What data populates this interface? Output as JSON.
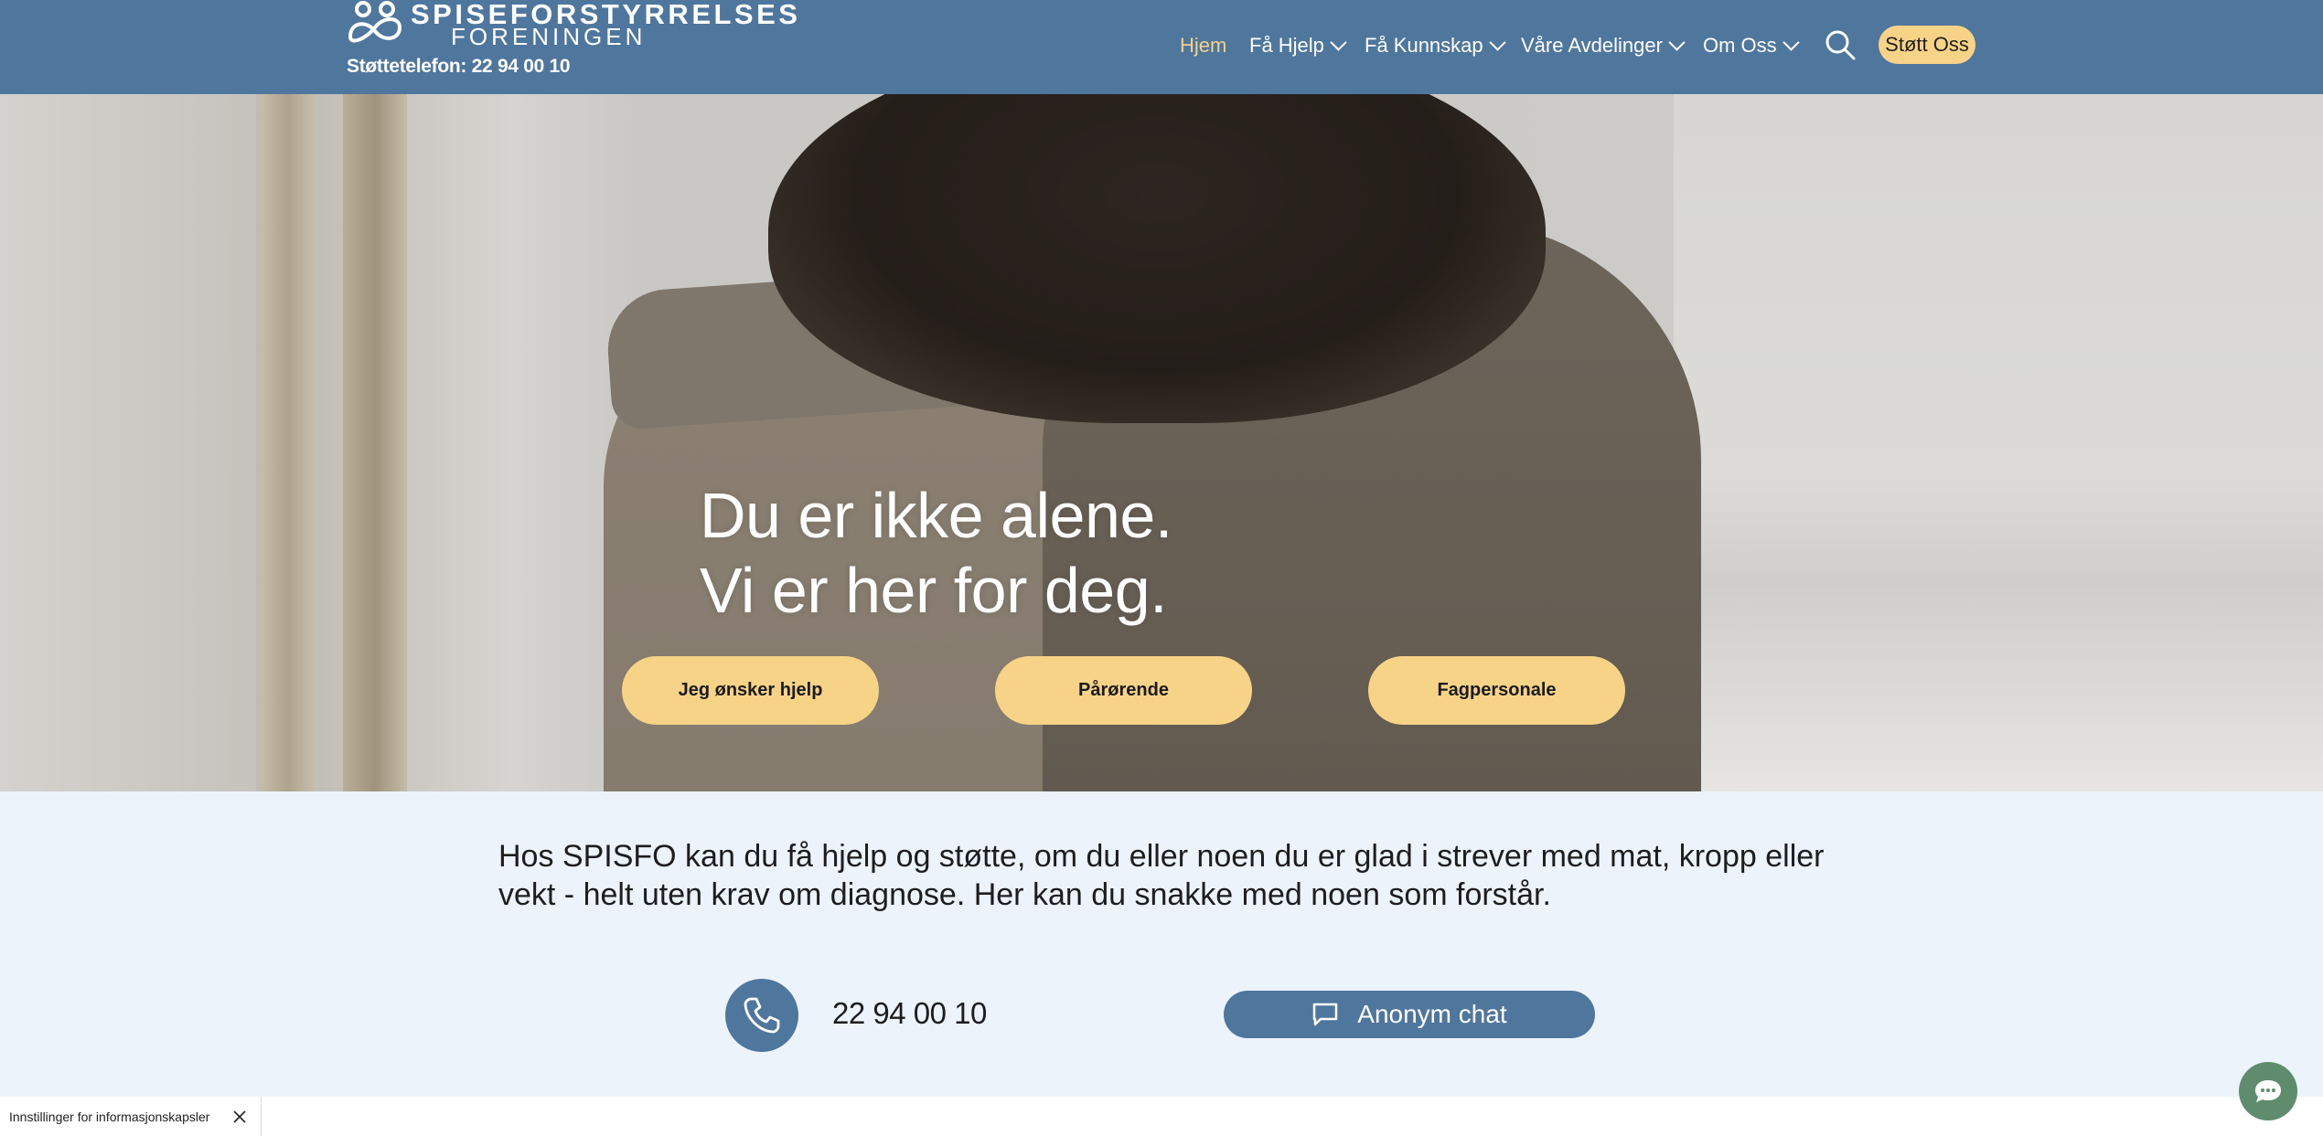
{
  "header": {
    "logo_line1": "SPISEFORSTYRRELSES",
    "logo_line2": "FORENINGEN",
    "support_phone": "Støttetelefon: 22 94 00 10",
    "nav": [
      {
        "label": "Hjem"
      },
      {
        "label": "Få Hjelp"
      },
      {
        "label": "Få Kunnskap"
      },
      {
        "label": "Våre Avdelinger"
      },
      {
        "label": "Om Oss"
      }
    ],
    "support_button": "Støtt Oss",
    "colors": {
      "bar": "#4f779e",
      "accent": "#f7d387",
      "active_nav": "#f5d08a"
    }
  },
  "hero": {
    "title_line1": "Du er ikke alene.",
    "title_line2": "Vi er her for deg.",
    "buttons": [
      {
        "label": "Jeg ønsker hjelp"
      },
      {
        "label": "Pårørende"
      },
      {
        "label": "Fagpersonale"
      }
    ]
  },
  "info": {
    "intro": "Hos SPISFO kan du få hjelp og støtte, om du eller noen du er glad i strever med mat, kropp eller vekt - helt uten krav om diagnose. Her kan du snakke med noen som forstår.",
    "phone": "22 94 00 10",
    "chat_button": "Anonym chat"
  },
  "cookie_bar": {
    "label": "Innstillinger for informasjonskapsler"
  },
  "icons": {
    "search": "search-icon",
    "phone": "phone-icon",
    "chat": "chat-icon",
    "close": "close-icon",
    "chat_widget": "chat-bubble-icon"
  }
}
